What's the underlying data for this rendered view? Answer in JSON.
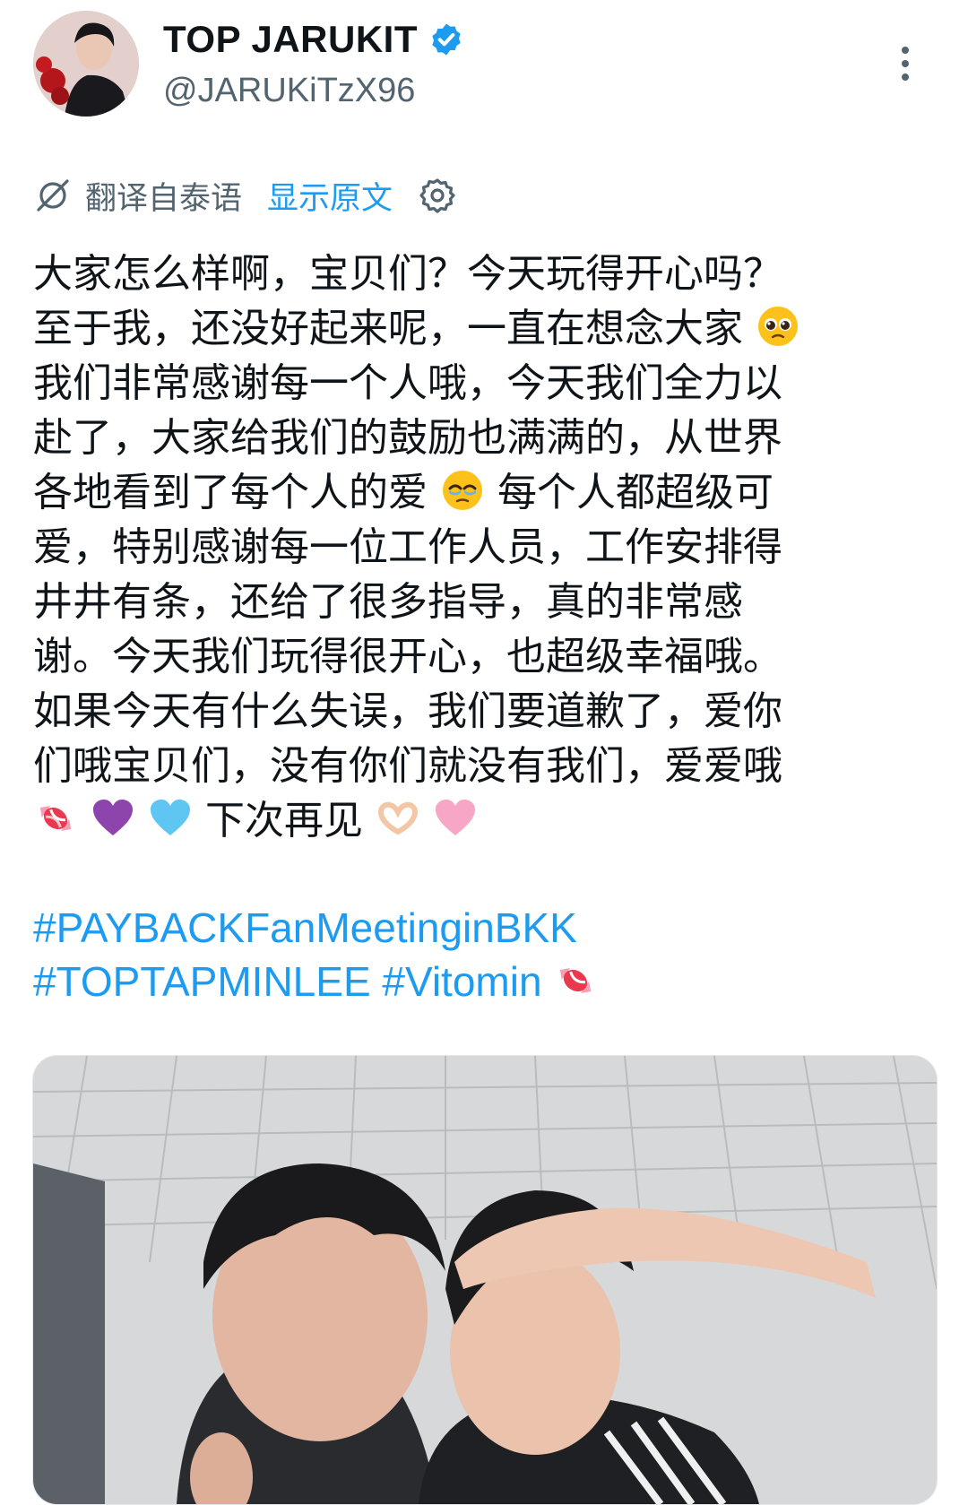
{
  "author": {
    "display_name": "TOP JARUKIT",
    "handle": "@JARUKiTzX96",
    "verified": true,
    "verified_color": "#1d9bf0"
  },
  "translation": {
    "translated_from": "翻译自泰语",
    "show_original": "显示原文",
    "icon": "translate-icon",
    "settings_icon": "gear-icon"
  },
  "tweet": {
    "lines": [
      "大家怎么样啊，宝贝们？今天玩得开心吗？",
      "至于我，还没好起来呢，一直在想念大家",
      "我们非常感谢每一个人哦，今天我们全力以",
      "赴了，大家给我们的鼓励也满满的，从世界",
      "各地看到了每个人的爱",
      "每个人都超级可",
      "爱，特别感谢每一位工作人员，工作安排得",
      "井井有条，还给了很多指导，真的非常感",
      "谢。今天我们玩得很开心，也超级幸福哦。",
      "如果今天有什么失误，我们要道歉了，爱你",
      "们哦宝贝们，没有你们就没有我们，爱爱哦",
      "下次再见"
    ],
    "emojis": [
      "pleading-face",
      "face-holding-back-tears",
      "candy",
      "purple-heart",
      "light-blue-heart",
      "heart-hands",
      "pink-heart"
    ]
  },
  "hashtags": [
    "#PAYBACKFanMeetinginBKK",
    "#TOPTAPMINLEE",
    "#Vitomin"
  ],
  "colors": {
    "link": "#1d9bf0",
    "secondary_text": "#536471",
    "text": "#0f1419"
  }
}
